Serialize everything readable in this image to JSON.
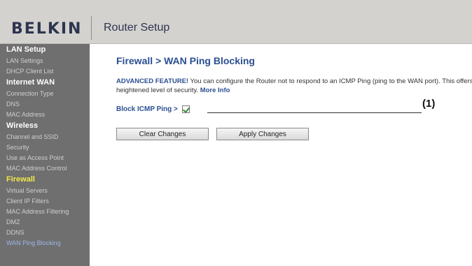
{
  "header": {
    "brand": "BELKIN",
    "title": "Router Setup"
  },
  "sidebar": {
    "items": [
      {
        "label": "LAN Setup",
        "kind": "head"
      },
      {
        "label": "LAN Settings",
        "kind": "item"
      },
      {
        "label": "DHCP Client List",
        "kind": "item"
      },
      {
        "label": "Internet WAN",
        "kind": "head"
      },
      {
        "label": "Connection Type",
        "kind": "item"
      },
      {
        "label": "DNS",
        "kind": "item"
      },
      {
        "label": "MAC Address",
        "kind": "item"
      },
      {
        "label": "Wireless",
        "kind": "head"
      },
      {
        "label": "Channel and SSID",
        "kind": "item"
      },
      {
        "label": "Security",
        "kind": "item"
      },
      {
        "label": "Use as Access Point",
        "kind": "item"
      },
      {
        "label": "MAC Address Control",
        "kind": "item"
      },
      {
        "label": "Firewall",
        "kind": "head-active"
      },
      {
        "label": "Virtual Servers",
        "kind": "item"
      },
      {
        "label": "Client IP Filters",
        "kind": "item"
      },
      {
        "label": "MAC Address Filtering",
        "kind": "item"
      },
      {
        "label": "DMZ",
        "kind": "item"
      },
      {
        "label": "DDNS",
        "kind": "item"
      },
      {
        "label": "WAN Ping Blocking",
        "kind": "current"
      }
    ]
  },
  "main": {
    "page_title": "Firewall > WAN Ping Blocking",
    "advanced_label": "ADVANCED FEATURE!",
    "description": " You can configure the Router not to respond to an ICMP Ping (ping to the WAN port). This offers a heightened level of security. ",
    "more_info": "More Info",
    "block_icmp_label": "Block ICMP Ping >",
    "block_icmp_checked": true,
    "callout": "(1)",
    "clear_button": "Clear Changes",
    "apply_button": "Apply Changes"
  },
  "colors": {
    "accent": "#2a4f92",
    "sidebar_bg": "#6f6f6f",
    "active_section": "#f0e84a",
    "header_bg": "#d4d2cf"
  }
}
